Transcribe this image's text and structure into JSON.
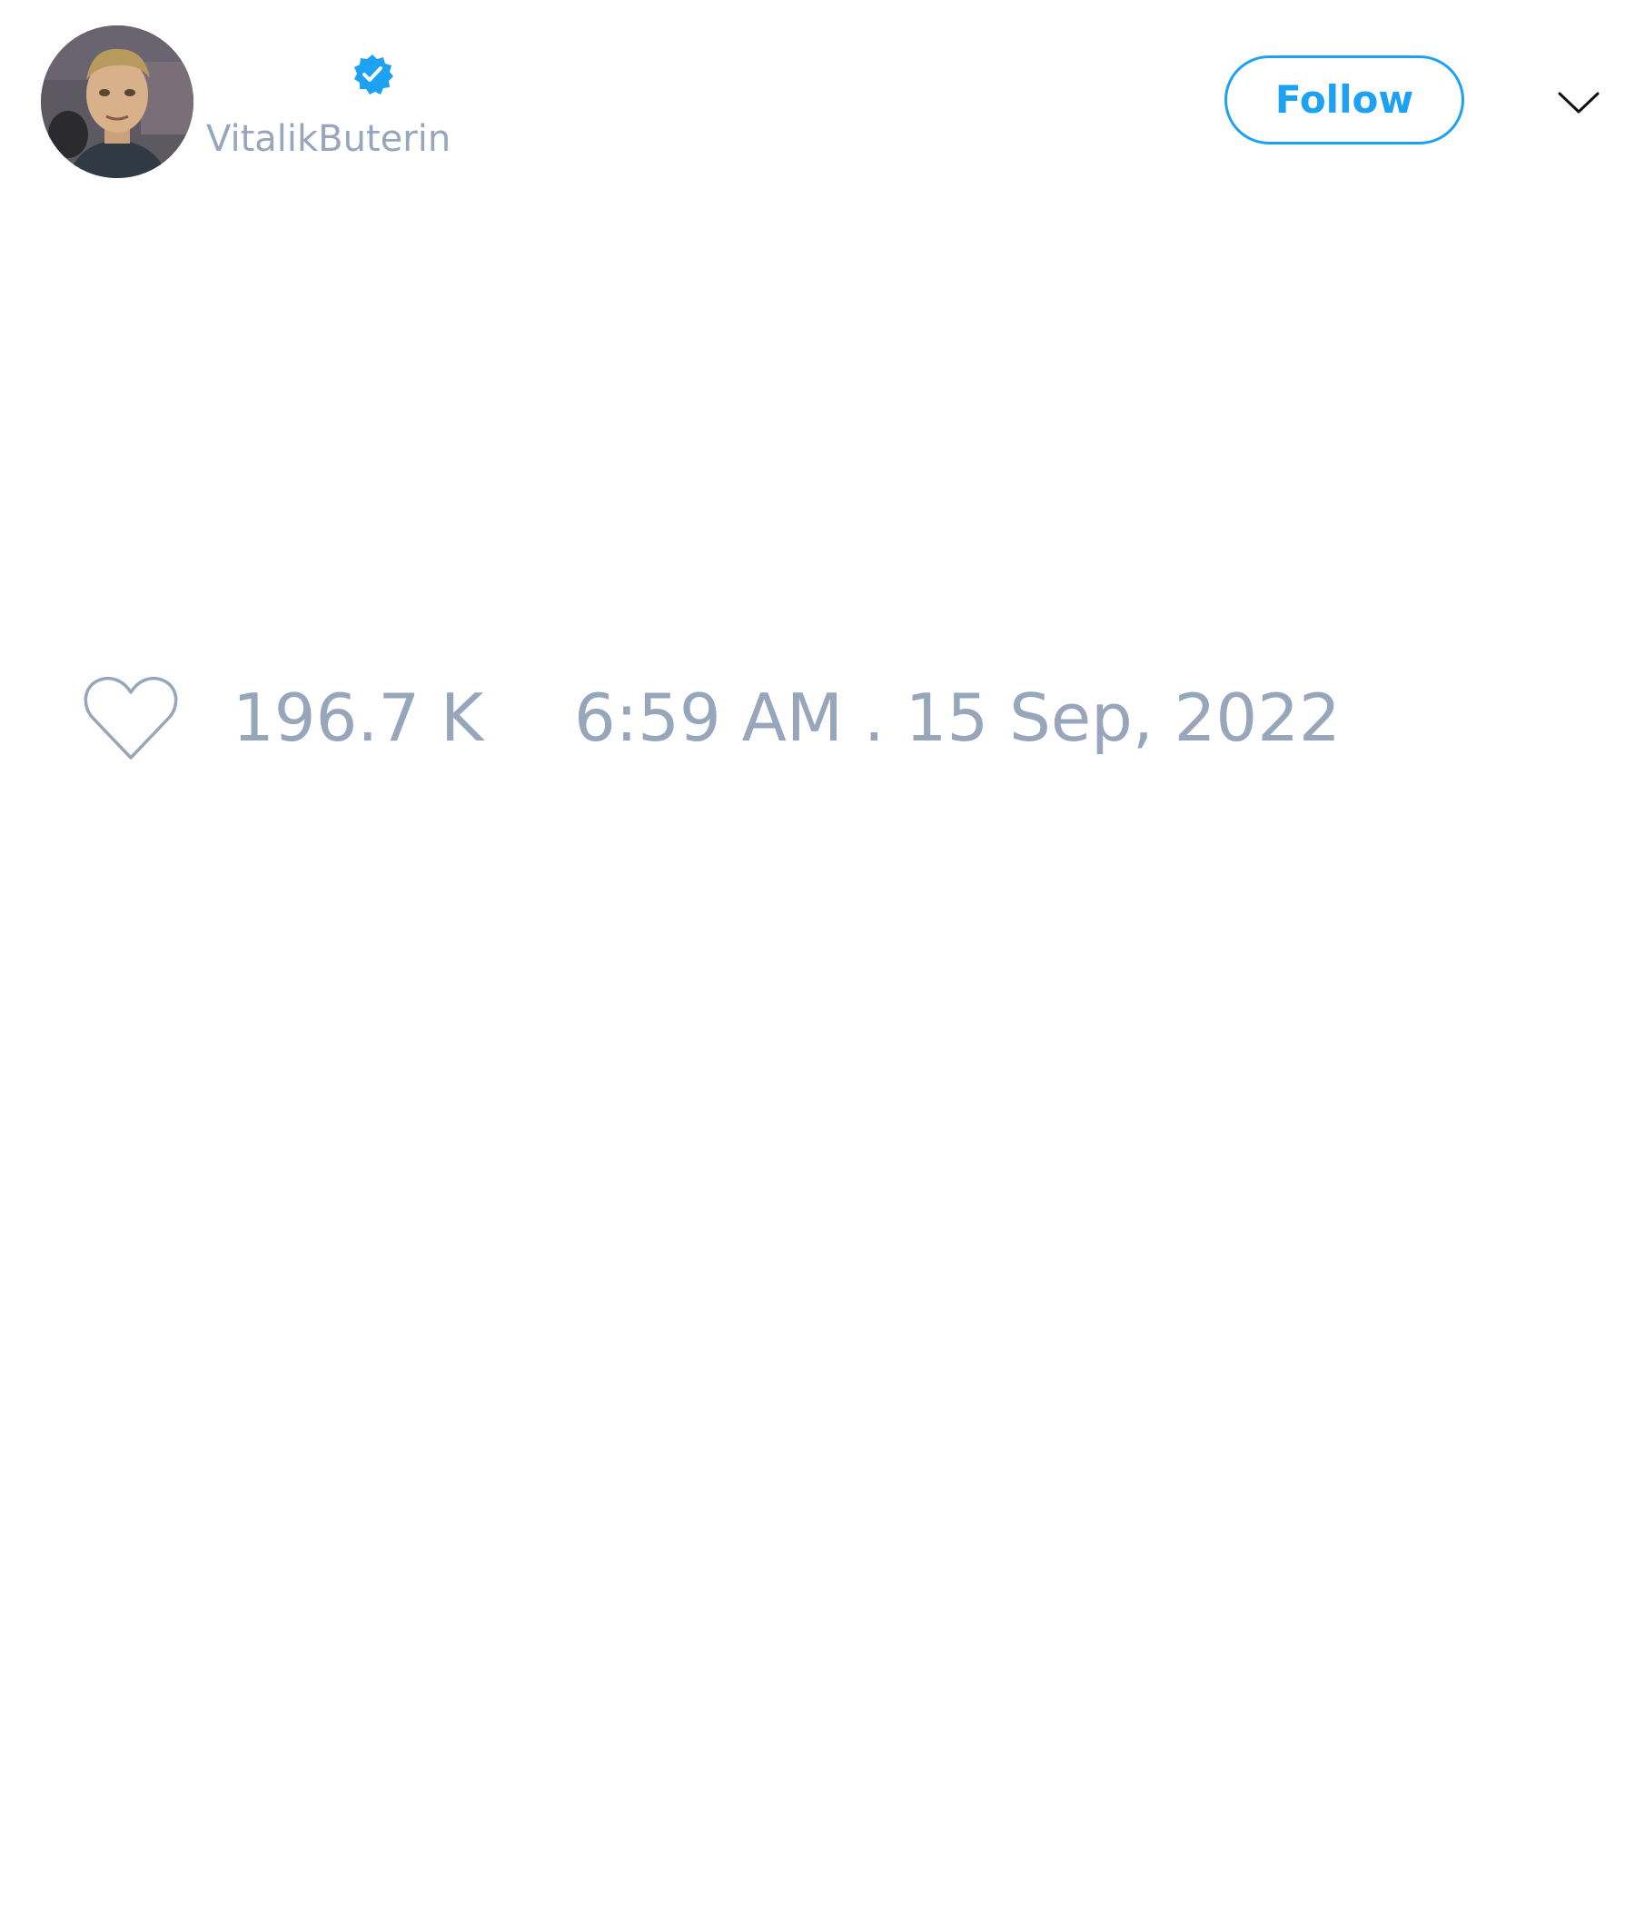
{
  "colors": {
    "accent": "#1da1f2",
    "muted_text": "#97a6ba",
    "background": "#ffffff"
  },
  "header": {
    "avatar_icon": "user-avatar",
    "verified_icon": "verified-badge-icon",
    "username": "VitalikButerin",
    "follow_label": "Follow",
    "menu_icon": "chevron-down-icon"
  },
  "footer": {
    "like_icon": "heart-icon",
    "like_count": "196.7 K",
    "timestamp": "6:59 AM . 15 Sep, 2022"
  }
}
